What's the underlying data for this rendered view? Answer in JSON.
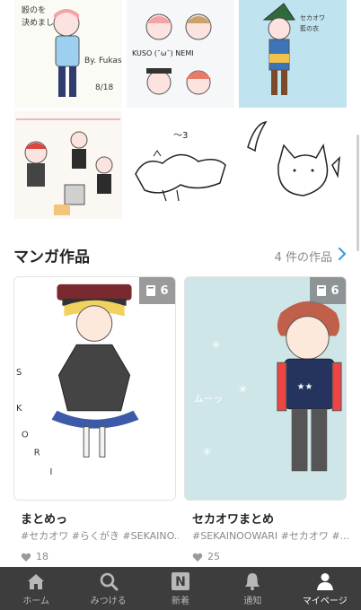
{
  "gallery": {
    "tiles": [
      {
        "alt": "illustration-boy-blue-hoodie",
        "caption": "By. Fukase"
      },
      {
        "alt": "illustration-kuso-nemi",
        "caption": "KUSO (˘ω˘) NEMI"
      },
      {
        "alt": "illustration-green-hat-character",
        "caption": ""
      },
      {
        "alt": "illustration-group-characters",
        "caption": ""
      },
      {
        "alt": "illustration-sleeping-figure",
        "caption": ""
      },
      {
        "alt": "illustration-cat-sketch",
        "caption": ""
      }
    ]
  },
  "section": {
    "title": "マンガ作品",
    "count": "4 件の作品"
  },
  "cards": [
    {
      "title": "まとめっ",
      "tags": "#セカオワ #らくがき #SEKAINO...",
      "likes": "18",
      "pages": "6"
    },
    {
      "title": "セカオワまとめ",
      "tags": "#SEKAINOOWARI #セカオワ #...",
      "likes": "25",
      "pages": "6"
    }
  ],
  "nav": [
    {
      "label": "ホーム",
      "icon": "home-icon"
    },
    {
      "label": "みつける",
      "icon": "search-icon"
    },
    {
      "label": "新着",
      "icon": "new-icon"
    },
    {
      "label": "通知",
      "icon": "bell-icon"
    },
    {
      "label": "マイページ",
      "icon": "user-icon"
    }
  ],
  "colors": {
    "nav_bg": "#3d3d3d",
    "accent": "#3aa0e0",
    "muted": "#8a8a8a"
  }
}
